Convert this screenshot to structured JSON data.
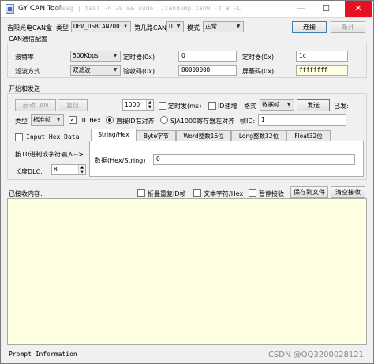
{
  "window": {
    "title": "GY CAN Tool",
    "ghost_text": "dmesg | tail -n 20 && sudo ./candump can0 -t a -L",
    "minimize": "—",
    "maximize": "☐",
    "close": "✕"
  },
  "device": {
    "label_device": "吉阳光电CAN盒",
    "label_type": "类型",
    "device_type": "DEV_USBCAN200",
    "label_channel": "第几路CAN",
    "channel": "0",
    "label_mode": "模式",
    "mode": "正常",
    "connect": "连接",
    "disconnect": "断开"
  },
  "can_config": {
    "section_title": "CAN通信配置",
    "baud_label": "波特率",
    "baud_value": "500Kbps",
    "timer0_label": "定时器(0x)",
    "timer0_value": "0",
    "timer1_label": "定时器(0x)",
    "timer1_value": "1c",
    "filter_mode_label": "滤波方式",
    "filter_mode_value": "双滤波",
    "acc_code_label": "验收码(0x)",
    "acc_code_value": "80000008",
    "mask_label": "屏蔽码(0x)",
    "mask_value": "ffffffff"
  },
  "send": {
    "section_title": "开始和发送",
    "start_can": "启动CAN",
    "reset": "复位",
    "interval_value": "1000",
    "timed_send_label": "定时发(ms)",
    "id_incr_label": "ID递增",
    "format_label": "格式",
    "format_value": "数据帧",
    "send_button": "发送",
    "sent_label": "已发:",
    "type_label": "类型",
    "frame_type": "标准帧",
    "id_hex_label": "ID Hex",
    "right_align_label": "直接ID右对齐",
    "sja_align_label": "SJA1000寄存器左对齐",
    "frame_id_label": "帧ID:",
    "frame_id_value": "1",
    "input_hex_label": "Input Hex Data",
    "input_prompt": "按10进制或字符输入-->",
    "dlc_label": "长度DLC:",
    "dlc_value": "8"
  },
  "tabs": [
    {
      "label": "String/Hex"
    },
    {
      "label": "Byte字节"
    },
    {
      "label": "Word整数16位"
    },
    {
      "label": "Long整数32位"
    },
    {
      "label": "Float32位"
    }
  ],
  "tab_content": {
    "data_label": "数据(Hex/String)",
    "data_value": "0"
  },
  "receive": {
    "label": "已接收内容:",
    "fold_label": "折叠重复ID帧",
    "text_hex_label": "文本字符/Hex",
    "pause_label": "暂停接收",
    "save_button": "保存到文件",
    "clear_button": "清空接收",
    "content": ""
  },
  "status": {
    "prompt": "Prompt Information",
    "watermark": "CSDN @QQ3200028121"
  }
}
